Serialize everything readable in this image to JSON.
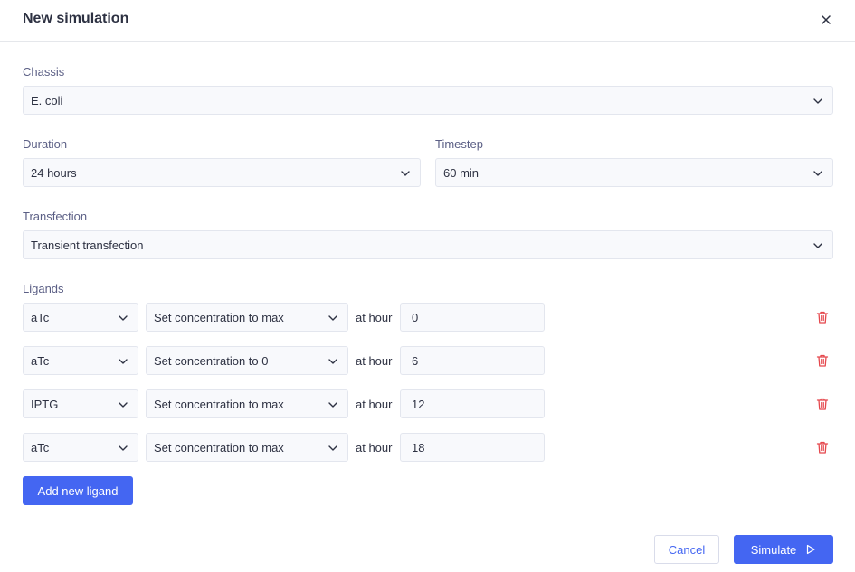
{
  "dialog": {
    "title": "New simulation"
  },
  "chassis": {
    "label": "Chassis",
    "value": "E. coli"
  },
  "duration": {
    "label": "Duration",
    "value": "24 hours"
  },
  "timestep": {
    "label": "Timestep",
    "value": "60 min"
  },
  "transfection": {
    "label": "Transfection",
    "value": "Transient transfection"
  },
  "ligands": {
    "label": "Ligands",
    "at_hour_label": "at hour",
    "rows": [
      {
        "ligand": "aTc",
        "action": "Set concentration to max",
        "hour": "0"
      },
      {
        "ligand": "aTc",
        "action": "Set concentration to 0",
        "hour": "6"
      },
      {
        "ligand": "IPTG",
        "action": "Set concentration to max",
        "hour": "12"
      },
      {
        "ligand": "aTc",
        "action": "Set concentration to max",
        "hour": "18"
      }
    ],
    "add_label": "Add new ligand"
  },
  "footer": {
    "cancel_label": "Cancel",
    "simulate_label": "Simulate"
  },
  "icons": {
    "close": "close-icon",
    "chevron": "chevron-down-icon",
    "trash": "trash-icon",
    "play": "play-icon"
  },
  "colors": {
    "primary": "#4466f2",
    "danger": "#e5484d",
    "label": "#5b5f85"
  }
}
